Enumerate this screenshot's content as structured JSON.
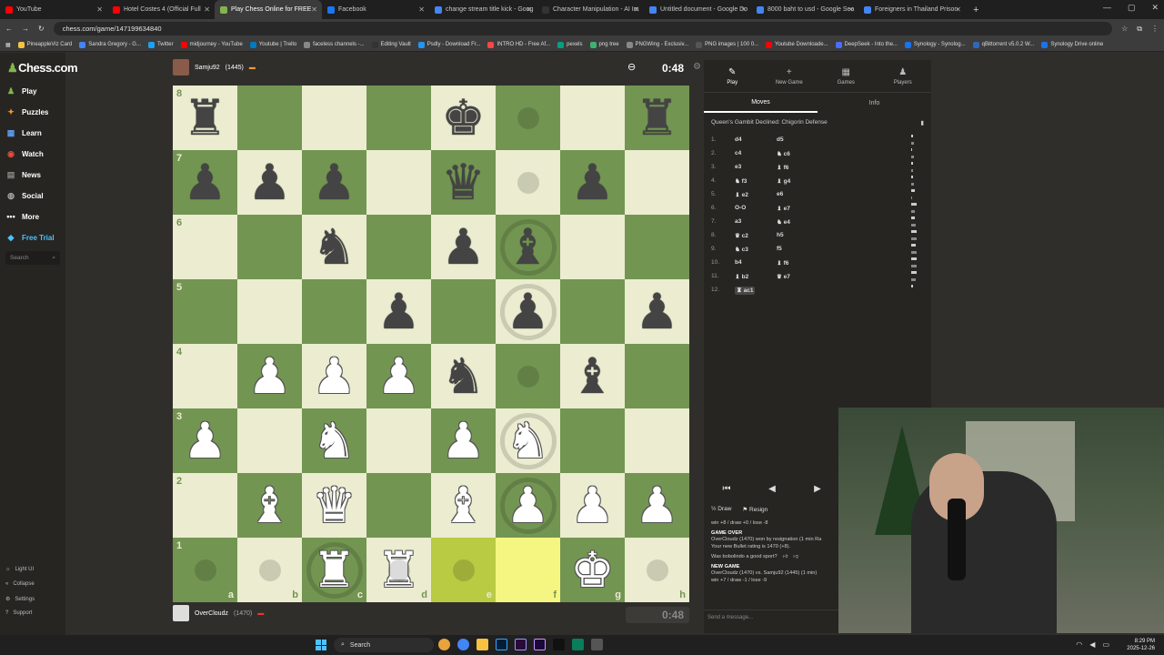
{
  "browser": {
    "tabs": [
      {
        "title": "YouTube",
        "color": "#ff0000"
      },
      {
        "title": "Hotel Costes 4 (Official Full",
        "color": "#ff0000"
      },
      {
        "title": "Play Chess Online for FREE",
        "color": "#81b64c",
        "active": true
      },
      {
        "title": "Facebook",
        "color": "#1877f2"
      },
      {
        "title": "change stream title kick - Goog",
        "color": "#4285f4"
      },
      {
        "title": "Character Manipulation - AI Im",
        "color": "#333333"
      },
      {
        "title": "Untitled document - Google Do",
        "color": "#4285f4"
      },
      {
        "title": "8000 baht to usd - Google Sea",
        "color": "#4285f4"
      },
      {
        "title": "Foreigners in Thailand Prison",
        "color": "#4285f4"
      }
    ],
    "url": "chess.com/game/147199634840",
    "bookmarks": [
      "PineappleViz Card",
      "Sandra Gregory - G...",
      "Twitter",
      "midjourney - YouTube",
      "Youtube | Trello",
      "faceless channels -...",
      "Editing Vault",
      "Psdly - Download Fr...",
      "INTRO HD - Free Af...",
      "pexels",
      "png tree",
      "PNGWing - Exclusiv...",
      "PNG images | 100 0...",
      "Youtube Downloade...",
      "DeepSeek - Into the...",
      "Synology - Synolog...",
      "qBittorrent v5.0.2 W...",
      "Synology Drive online"
    ]
  },
  "nav": {
    "logo": "Chess.com",
    "items": [
      {
        "label": "Play",
        "icon": "♟"
      },
      {
        "label": "Puzzles",
        "icon": "✦"
      },
      {
        "label": "Learn",
        "icon": "▦"
      },
      {
        "label": "Watch",
        "icon": "◉"
      },
      {
        "label": "News",
        "icon": "▤"
      },
      {
        "label": "Social",
        "icon": "◍"
      },
      {
        "label": "More",
        "icon": "•••"
      },
      {
        "label": "Free Trial",
        "icon": "◆"
      }
    ],
    "search_placeholder": "Search",
    "bottom": [
      "Light UI",
      "Collapse",
      "Settings",
      "Support"
    ]
  },
  "top_player": {
    "name": "Samju92",
    "rating": "(1445)",
    "clock": "0:48"
  },
  "bottom_player": {
    "name": "OverCloudz",
    "rating": "(1470)",
    "clock": "0:48"
  },
  "board": {
    "ranks": [
      "8",
      "7",
      "6",
      "5",
      "4",
      "3",
      "2",
      "1"
    ],
    "files": [
      "a",
      "b",
      "c",
      "d",
      "e",
      "f",
      "g",
      "h"
    ],
    "position": [
      [
        "r",
        "",
        "",
        "",
        "k",
        "",
        "",
        "r"
      ],
      [
        "p",
        "p",
        "p",
        "",
        "q",
        "",
        "p",
        ""
      ],
      [
        "",
        "",
        "n",
        "",
        "p",
        "b",
        "",
        ""
      ],
      [
        "",
        "",
        "",
        "p",
        "",
        "p",
        "",
        "p"
      ],
      [
        "",
        "P",
        "P",
        "P",
        "n",
        "",
        "b",
        ""
      ],
      [
        "P",
        "",
        "N",
        "",
        "P",
        "N",
        "",
        ""
      ],
      [
        "",
        "B",
        "Q",
        "",
        "B",
        "P",
        "P",
        "P"
      ],
      [
        "",
        "",
        "R",
        "R",
        "",
        "",
        "K",
        ""
      ]
    ],
    "highlights": [
      "e1",
      "f1"
    ],
    "hints": [
      "f8",
      "f7",
      "f4",
      "a1",
      "b1",
      "d1",
      "e1",
      "h1"
    ],
    "rings": [
      "f6",
      "f5",
      "f3",
      "f2",
      "c1"
    ]
  },
  "panel": {
    "tabs": [
      {
        "label": "Play",
        "icon": "✎"
      },
      {
        "label": "New Game",
        "icon": "+"
      },
      {
        "label": "Games",
        "icon": "▦"
      },
      {
        "label": "Players",
        "icon": "♟"
      }
    ],
    "subtabs": [
      "Moves",
      "Info"
    ],
    "opening": "Queen's Gambit Declined: Chigorin Defense",
    "moves": [
      {
        "n": "1.",
        "w": "d4",
        "b": "d5",
        "tw": 0.5,
        "tb": 0.7
      },
      {
        "n": "2.",
        "w": "c4",
        "b": "♞ c6",
        "tw": 0.3,
        "tb": 0.7
      },
      {
        "n": "3.",
        "w": "e3",
        "b": "♝ f6",
        "tw": 0.6,
        "tb": 0.6
      },
      {
        "n": "4.",
        "w": "♞ f3",
        "b": "♝ g4",
        "tw": 0.6,
        "tb": 0.8
      },
      {
        "n": "5.",
        "w": "♝ e2",
        "b": "e6",
        "tw": 0.9,
        "tb": 0.3
      },
      {
        "n": "6.",
        "w": "O-O",
        "b": "♝ e7",
        "tw": 1.5,
        "tb": 1.0
      },
      {
        "n": "7.",
        "w": "a3",
        "b": "♞ e4",
        "tw": 0.9,
        "tb": 1.2
      },
      {
        "n": "8.",
        "w": "♛ c2",
        "b": "h5",
        "tw": 1.6,
        "tb": 1.4
      },
      {
        "n": "9.",
        "w": "♞ c3",
        "b": "f5",
        "tw": 1.2,
        "tb": 1.4
      },
      {
        "n": "10.",
        "w": "b4",
        "b": "♝ f6",
        "tw": 1.6,
        "tb": 1.5
      },
      {
        "n": "11.",
        "w": "♝ b2",
        "b": "♛ e7",
        "tw": 1.6,
        "tb": 1.3
      },
      {
        "n": "12.",
        "w": "♜ ac1",
        "b": "",
        "tw": 0.5,
        "tb": 0
      }
    ],
    "draw_label": "Draw",
    "resign_label": "Resign",
    "chat": {
      "score_line": "win +8 / draw +0 / lose -8",
      "game_over": "GAME OVER",
      "result": "OverCloudz (1470) won by resignation (1 min Ra",
      "rating_line": "Your new Bullet rating is 1470 (+8).",
      "sport_question": "Was bobolindo a good sport?",
      "new_game": "NEW GAME",
      "matchup": "OverCloudz (1470) vs. Samju92 (1445) (1 min)",
      "stakes": "win +7 / draw -1 / lose -9"
    },
    "send_placeholder": "Send a message..."
  },
  "taskbar": {
    "search_label": "Search",
    "time": "8:29 PM",
    "date": "2025-12-26"
  }
}
